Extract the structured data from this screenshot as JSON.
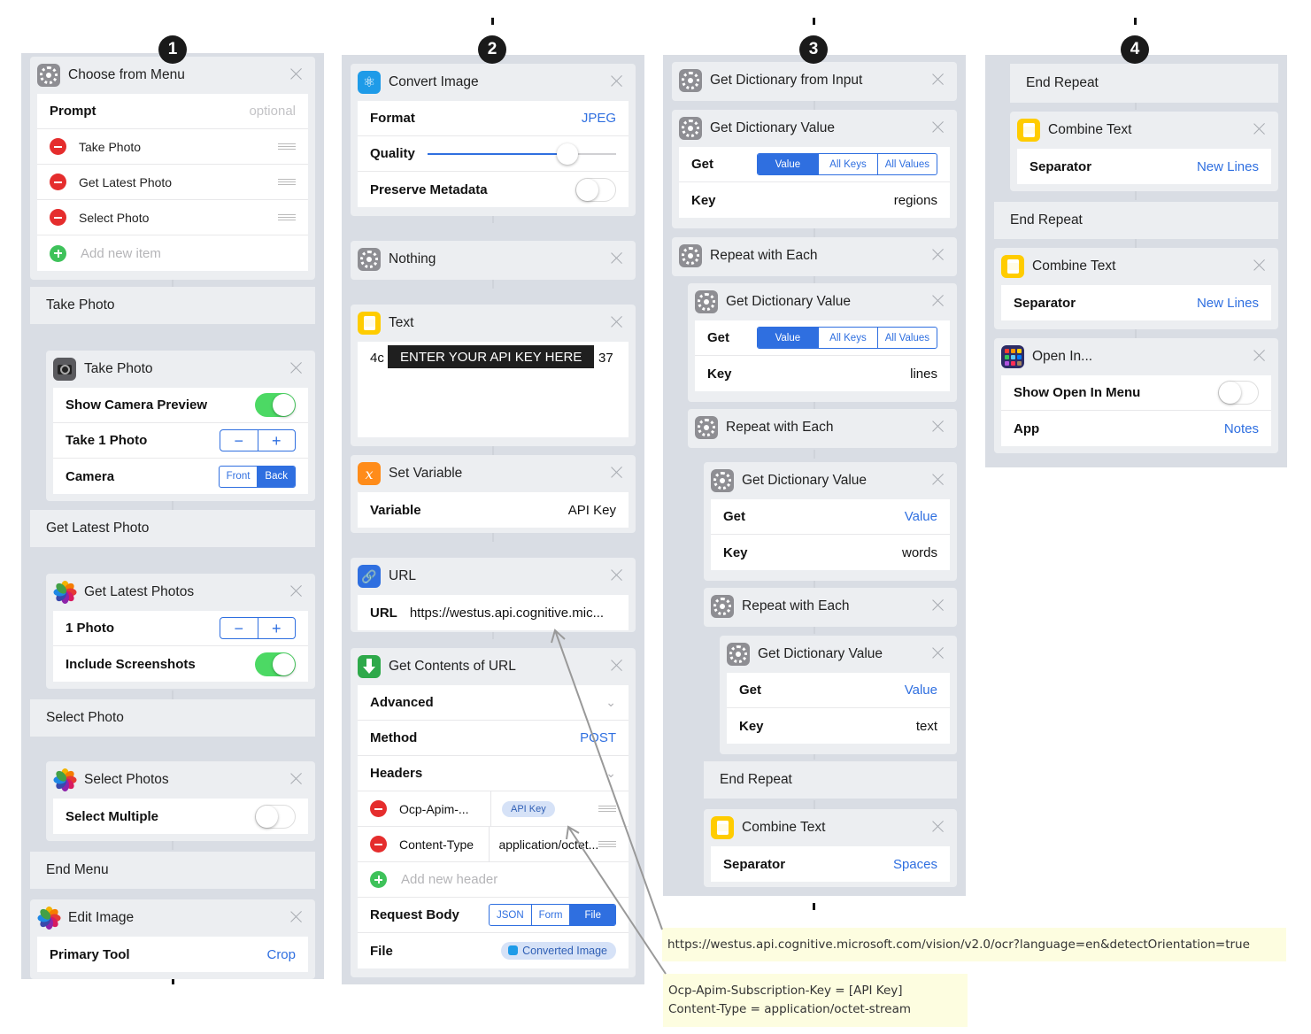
{
  "badges": [
    "1",
    "2",
    "3",
    "4"
  ],
  "col1": {
    "menu": {
      "title": "Choose from Menu",
      "prompt_label": "Prompt",
      "prompt_placeholder": "optional",
      "items": [
        "Take Photo",
        "Get Latest Photo",
        "Select Photo"
      ],
      "add_item": "Add new item"
    },
    "case_take_photo": "Take Photo",
    "take_photo": {
      "title": "Take Photo",
      "show_preview": "Show Camera Preview",
      "take_count": "Take 1 Photo",
      "camera_label": "Camera",
      "camera_front": "Front",
      "camera_back": "Back",
      "minus": "−",
      "plus": "+"
    },
    "case_latest": "Get Latest Photo",
    "latest": {
      "title": "Get Latest Photos",
      "count": "1 Photo",
      "screenshots": "Include Screenshots",
      "minus": "−",
      "plus": "+"
    },
    "case_select": "Select Photo",
    "select": {
      "title": "Select Photos",
      "multiple": "Select Multiple"
    },
    "end_menu": "End Menu",
    "edit": {
      "title": "Edit Image",
      "tool_label": "Primary Tool",
      "tool_value": "Crop"
    }
  },
  "col2": {
    "convert": {
      "title": "Convert Image",
      "format_label": "Format",
      "format_value": "JPEG",
      "quality_label": "Quality",
      "quality": 0.74,
      "metadata_label": "Preserve Metadata"
    },
    "nothing": "Nothing",
    "text": {
      "title": "Text",
      "left": "4c",
      "banner": "ENTER YOUR API KEY HERE",
      "right": "37"
    },
    "setvar": {
      "title": "Set Variable",
      "label": "Variable",
      "value": "API Key"
    },
    "url": {
      "title": "URL",
      "label": "URL",
      "value": "https://westus.api.cognitive.mic..."
    },
    "contents": {
      "title": "Get Contents of URL",
      "advanced": "Advanced",
      "method_label": "Method",
      "method_value": "POST",
      "headers": "Headers",
      "h1_key": "Ocp-Apim-...",
      "h1_val": "API Key",
      "h2_key": "Content-Type",
      "h2_val": "application/octet...",
      "add_header": "Add new header",
      "body_label": "Request Body",
      "body_opts": [
        "JSON",
        "Form",
        "File"
      ],
      "file_label": "File",
      "file_val": "Converted Image"
    }
  },
  "col3": {
    "from_input": "Get Dictionary from Input",
    "dv1": {
      "title": "Get Dictionary Value",
      "get": "Get",
      "opts": [
        "Value",
        "All Keys",
        "All Values"
      ],
      "key": "Key",
      "key_val": "regions"
    },
    "rep1": "Repeat with Each",
    "dv2": {
      "title": "Get Dictionary Value",
      "get": "Get",
      "opts": [
        "Value",
        "All Keys",
        "All Values"
      ],
      "key": "Key",
      "key_val": "lines"
    },
    "rep2": "Repeat with Each",
    "dv3": {
      "title": "Get Dictionary Value",
      "get": "Get",
      "get_val": "Value",
      "key": "Key",
      "key_val": "words"
    },
    "rep3": "Repeat with Each",
    "dv4": {
      "title": "Get Dictionary Value",
      "get": "Get",
      "get_val": "Value",
      "key": "Key",
      "key_val": "text"
    },
    "end_repeat": "End Repeat",
    "combine": {
      "title": "Combine Text",
      "sep": "Separator",
      "sep_val": "Spaces"
    }
  },
  "col4": {
    "end_repeat1": "End Repeat",
    "combine1": {
      "title": "Combine Text",
      "sep": "Separator",
      "sep_val": "New Lines"
    },
    "end_repeat2": "End Repeat",
    "combine2": {
      "title": "Combine Text",
      "sep": "Separator",
      "sep_val": "New Lines"
    },
    "open": {
      "title": "Open In...",
      "menu_label": "Show Open In Menu",
      "app_label": "App",
      "app_val": "Notes"
    }
  },
  "notes": {
    "url": "https://westus.api.cognitive.microsoft.com/vision/v2.0/ocr?language=en&detectOrientation=true",
    "h1": "Ocp-Apim-Subscription-Key = [API Key]",
    "h2": "Content-Type = application/octet-stream"
  },
  "colors": {
    "blue": "#2f6fe0",
    "green": "#4cd964",
    "red": "#e52d2d",
    "column": "#d9dde4",
    "card": "#eceef1",
    "note": "#fdfde0"
  }
}
